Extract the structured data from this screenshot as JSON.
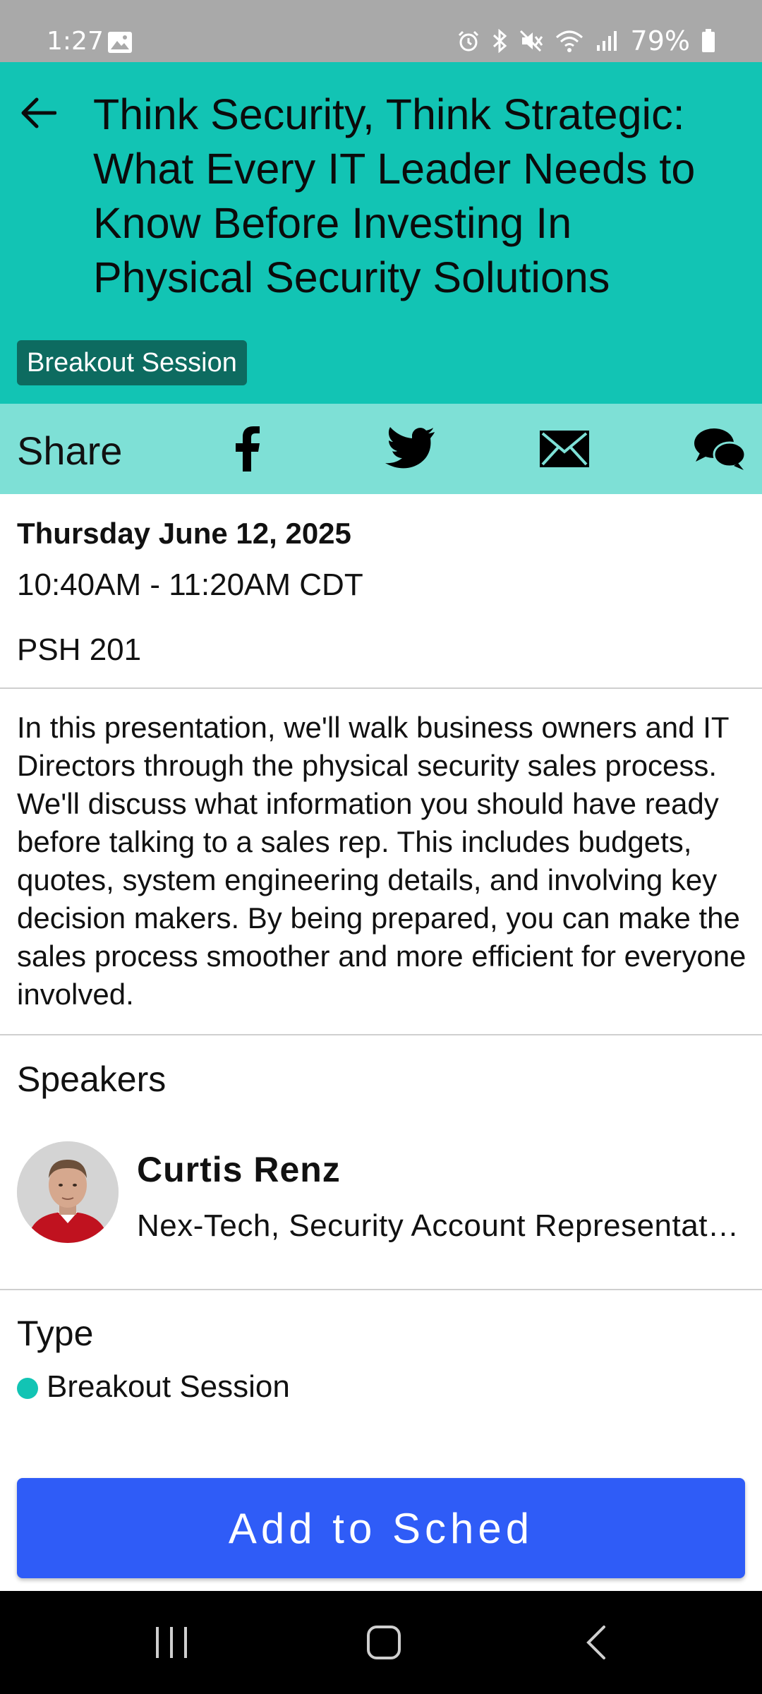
{
  "status_bar": {
    "time": "1:27",
    "battery": "79%",
    "icons": [
      "gallery-icon",
      "alarm-icon",
      "bluetooth-icon",
      "mute-icon",
      "wifi-icon",
      "signal-icon",
      "battery-icon"
    ]
  },
  "header": {
    "back_icon": "arrow-left-icon",
    "title": "Think Security, Think Strategic: What Every IT Leader Needs to Know Before Investing In Physical Security Solutions",
    "tag": "Breakout Session",
    "background": "#12c4b4",
    "tag_color": "#0d6b60"
  },
  "share": {
    "label": "Share",
    "icons": [
      "facebook-icon",
      "twitter-icon",
      "email-icon",
      "chat-icon"
    ],
    "background": "#7ee0d6"
  },
  "session": {
    "date": "Thursday June 12, 2025",
    "time": "10:40AM - 11:20AM CDT",
    "room": "PSH 201",
    "description": "In this presentation, we'll walk business owners and IT Directors through the physical security sales process. We'll discuss what information you should have ready before talking to a sales rep. This includes budgets, quotes, system engineering details, and involving key decision makers. By being prepared, you can make the sales process smoother and more efficient for everyone involved."
  },
  "speakers": {
    "heading": "Speakers",
    "items": [
      {
        "name": "Curtis Renz",
        "role": "Nex-Tech, Security Account Representative"
      }
    ]
  },
  "type": {
    "heading": "Type",
    "value": "Breakout Session",
    "dot_color": "#12c4b4"
  },
  "cta": {
    "label": "Add to Sched",
    "color": "#2f5cf7"
  },
  "nav": {
    "icons": [
      "recent-apps-icon",
      "home-icon",
      "back-icon"
    ]
  }
}
